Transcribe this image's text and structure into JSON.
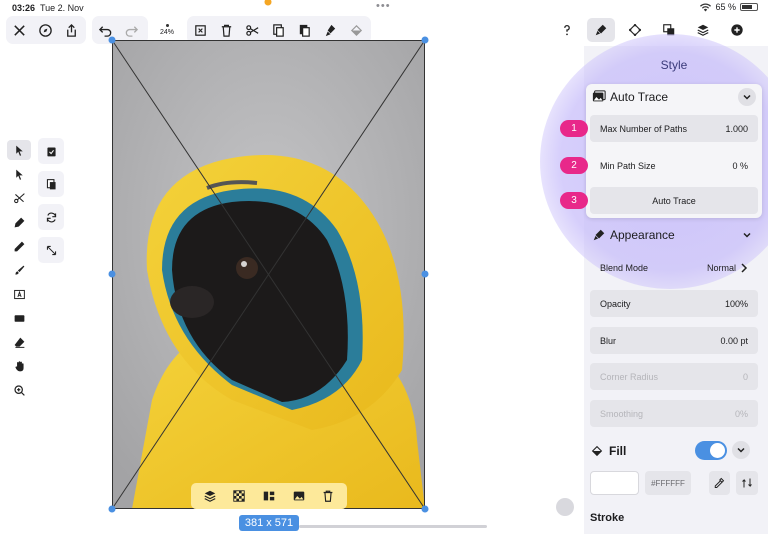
{
  "status": {
    "time": "03:26",
    "date": "Tue 2. Nov",
    "battery": "65 %"
  },
  "toolbar": {
    "zoom": "24%"
  },
  "canvas": {
    "dimensions": "381 x 571"
  },
  "panel": {
    "title": "Style",
    "auto_trace": {
      "title": "Auto Trace",
      "max_paths_label": "Max Number of Paths",
      "max_paths_value": "1.000",
      "min_path_label": "Min Path Size",
      "min_path_value": "0 %",
      "button": "Auto Trace"
    },
    "appearance": {
      "title": "Appearance",
      "blend_label": "Blend Mode",
      "blend_value": "Normal",
      "opacity_label": "Opacity",
      "opacity_value": "100%",
      "blur_label": "Blur",
      "blur_value": "0.00 pt",
      "corner_label": "Corner Radius",
      "corner_value": "0",
      "smoothing_label": "Smoothing",
      "smoothing_value": "0%"
    },
    "fill": {
      "title": "Fill",
      "hex": "#FFFFFF",
      "color": "#ffffff"
    },
    "stroke": {
      "title": "Stroke"
    }
  },
  "badges": [
    "1",
    "2",
    "3"
  ],
  "colors": {
    "accent": "#4a90e2",
    "badge": "#e8288a",
    "halo": "#c8befa",
    "bottom_bar": "#fde99a"
  }
}
